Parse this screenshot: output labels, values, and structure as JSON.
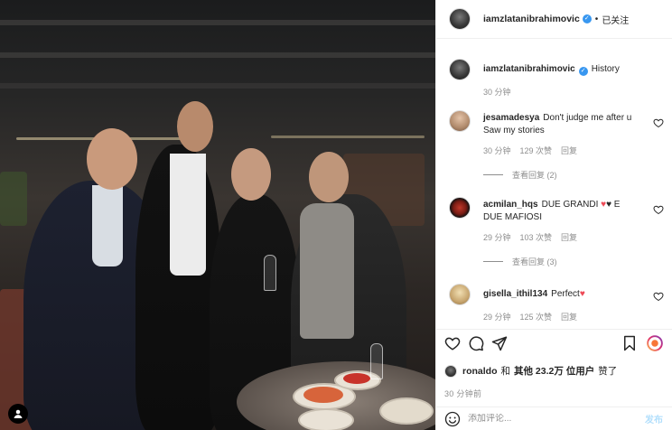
{
  "post": {
    "username": "iamzlatanibrahimovic",
    "follow_status": "已关注",
    "caption_user": "iamzlatanibrahimovic",
    "caption_text": "History",
    "caption_time": "30 分钟"
  },
  "comments": [
    {
      "username": "jesamadesya",
      "text": "Don't judge me after u Saw my stories",
      "time": "30 分钟",
      "likes": "129 次赞",
      "reply_label": "回复",
      "view_replies": "查看回复 (2)"
    },
    {
      "username": "acmilan_hqs",
      "text_before": "DUE GRANDI ",
      "text_after": " E DUE MAFIOSI",
      "time": "29 分钟",
      "likes": "103 次赞",
      "reply_label": "回复",
      "view_replies": "查看回复 (3)"
    },
    {
      "username": "gisella_ithil134",
      "text": "Perfect",
      "time": "29 分钟",
      "likes": "125 次赞",
      "reply_label": "回复"
    }
  ],
  "likes": {
    "user": "ronaldo",
    "connector": "和",
    "others_label": "其他 23.2万 位用户",
    "suffix": "赞了"
  },
  "time_ago": "30 分钟前",
  "add_comment": {
    "placeholder": "添加评论...",
    "post_label": "发布"
  },
  "icons": {
    "like": "heart-outline-icon",
    "comment": "comment-bubble-icon",
    "share": "paper-plane-icon",
    "save": "bookmark-icon",
    "emoji": "smiley-icon"
  },
  "colors": {
    "verified_blue": "#3897f0",
    "heart_red": "#ed4956",
    "post_button_disabled": "#b2dffc"
  }
}
